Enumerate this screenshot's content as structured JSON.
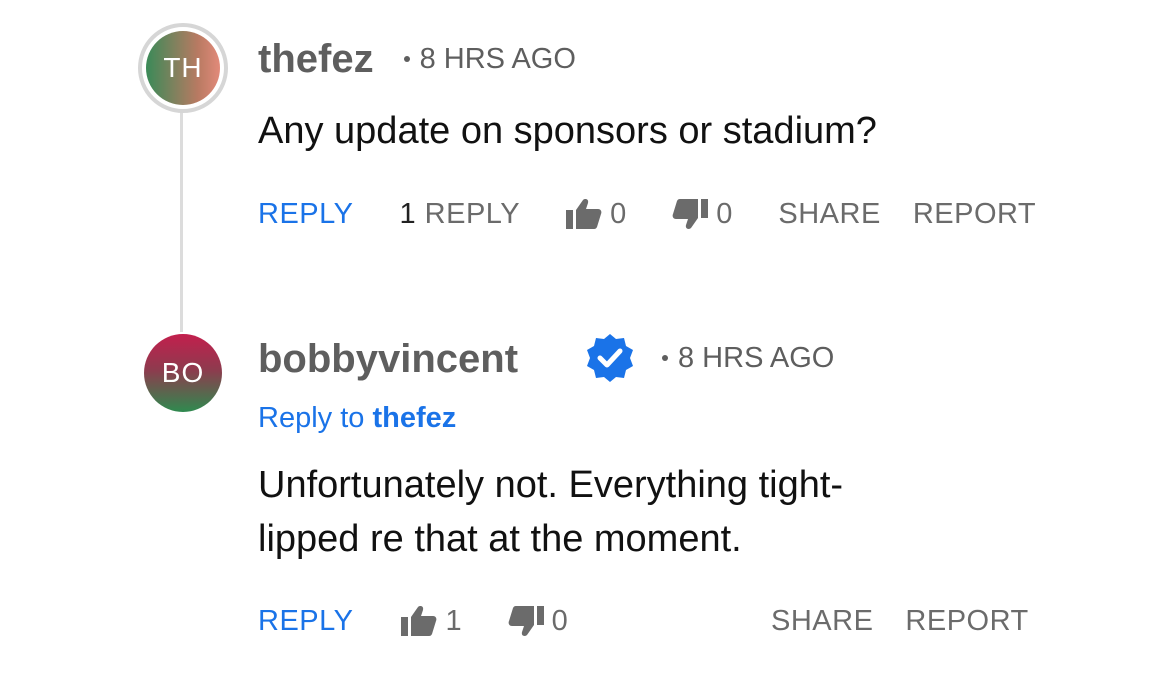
{
  "comments": [
    {
      "avatar_initials": "TH",
      "username": "thefez",
      "timestamp": "8 HRS AGO",
      "text": "Any update on sponsors or stadium?",
      "actions": {
        "reply_label": "REPLY",
        "replies_count": "1",
        "replies_label": "REPLY",
        "likes": "0",
        "dislikes": "0",
        "share_label": "SHARE",
        "report_label": "REPORT"
      }
    },
    {
      "avatar_initials": "BO",
      "username": "bobbyvincent",
      "verified": true,
      "timestamp": "8 HRS AGO",
      "reply_to_prefix": "Reply to",
      "reply_to_user": "thefez",
      "text_line1": "Unfortunately not. Everything tight-",
      "text_line2": "lipped re that at the moment.",
      "actions": {
        "reply_label": "REPLY",
        "likes": "1",
        "dislikes": "0",
        "share_label": "SHARE",
        "report_label": "REPORT"
      }
    }
  ],
  "icons": {
    "like": "thumbs-up-icon",
    "dislike": "thumbs-down-icon",
    "verified": "verified-check-icon"
  },
  "colors": {
    "link_blue": "#1a73e8",
    "muted_gray": "#6b6b6b",
    "verified_blue": "#1a73e8"
  }
}
